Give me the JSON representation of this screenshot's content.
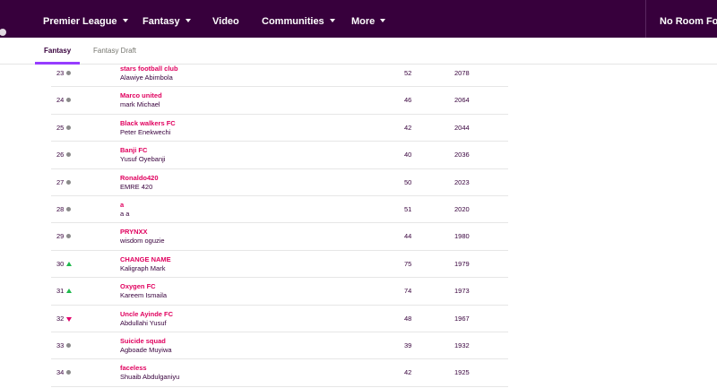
{
  "nav": {
    "items": [
      {
        "label": "Premier League",
        "caret": true
      },
      {
        "label": "Fantasy",
        "caret": true,
        "active": true
      },
      {
        "label": "Video",
        "caret": false
      },
      {
        "label": "Communities",
        "caret": true
      },
      {
        "label": "More",
        "caret": true
      }
    ],
    "promo": "No Room Fo"
  },
  "subnav": {
    "tabs": [
      {
        "label": "Fantasy",
        "active": true
      },
      {
        "label": "Fantasy Draft",
        "active": false
      }
    ]
  },
  "standings": [
    {
      "rank": "23",
      "movement": "same",
      "team": "stars football club",
      "manager": "Alawiye Abimbola",
      "gw": "52",
      "total": "2078"
    },
    {
      "rank": "24",
      "movement": "same",
      "team": "Marco united",
      "manager": "mark Michael",
      "gw": "46",
      "total": "2064"
    },
    {
      "rank": "25",
      "movement": "same",
      "team": "Black walkers FC",
      "manager": "Peter Enekwechi",
      "gw": "42",
      "total": "2044"
    },
    {
      "rank": "26",
      "movement": "same",
      "team": "Banji FC",
      "manager": "Yusuf Oyebanji",
      "gw": "40",
      "total": "2036"
    },
    {
      "rank": "27",
      "movement": "same",
      "team": "Ronaldo420",
      "manager": "EMRE 420",
      "gw": "50",
      "total": "2023"
    },
    {
      "rank": "28",
      "movement": "same",
      "team": "a",
      "manager": "a a",
      "gw": "51",
      "total": "2020"
    },
    {
      "rank": "29",
      "movement": "same",
      "team": "PRYNXX",
      "manager": "wisdom oguzie",
      "gw": "44",
      "total": "1980"
    },
    {
      "rank": "30",
      "movement": "up",
      "team": "CHANGE NAME",
      "manager": "Kaligraph Mark",
      "gw": "75",
      "total": "1979"
    },
    {
      "rank": "31",
      "movement": "up",
      "team": "Oxygen FC",
      "manager": "Kareem Ismaila",
      "gw": "74",
      "total": "1973"
    },
    {
      "rank": "32",
      "movement": "down",
      "team": "Uncle Ayinde FC",
      "manager": "Abdullahi Yusuf",
      "gw": "48",
      "total": "1967"
    },
    {
      "rank": "33",
      "movement": "same",
      "team": "Suicide squad",
      "manager": "Agboade Muyiwa",
      "gw": "39",
      "total": "1932"
    },
    {
      "rank": "34",
      "movement": "same",
      "team": "faceless",
      "manager": "Shuaib Abdulganiyu",
      "gw": "42",
      "total": "1925"
    }
  ],
  "colors": {
    "brand": "#37003c",
    "team_link": "#e0005e",
    "rise": "#1fb84c",
    "fall": "#e1006b",
    "no_change": "#8a8a8a",
    "tab_underline": "#963cff"
  }
}
